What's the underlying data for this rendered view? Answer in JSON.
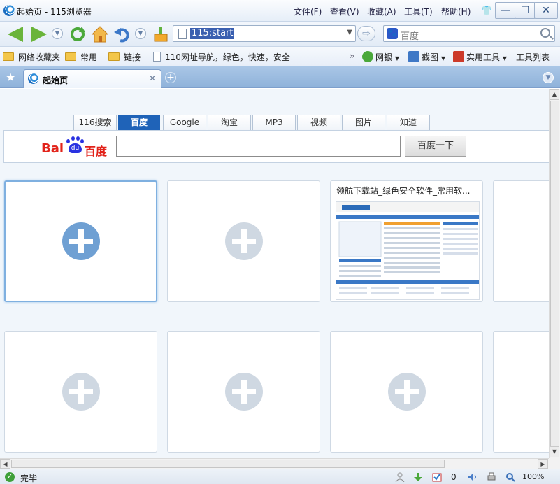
{
  "window": {
    "title": "起始页 - 115浏览器",
    "menu": [
      "文件(F)",
      "查看(V)",
      "收藏(A)",
      "工具(T)",
      "帮助(H)"
    ]
  },
  "navbar": {
    "url": "115:start",
    "search_placeholder": "百度"
  },
  "bookmarks": {
    "left": [
      {
        "label": "网络收藏夹",
        "icon": "folder-icon"
      },
      {
        "label": "常用",
        "icon": "folder-icon"
      },
      {
        "label": "链接",
        "icon": "folder-icon"
      },
      {
        "label": "110网址导航，绿色，快速，安全",
        "icon": "page-icon"
      }
    ],
    "right": [
      {
        "label": "网银",
        "icon": "bank-icon"
      },
      {
        "label": "截图",
        "icon": "screenshot-icon"
      },
      {
        "label": "实用工具",
        "icon": "toolbox-icon"
      },
      {
        "label": "工具列表",
        "icon": ""
      }
    ]
  },
  "tabs": {
    "active": "起始页"
  },
  "search_panel": {
    "tabs": [
      "116搜索",
      "百度",
      "Google",
      "淘宝",
      "MP3",
      "视频",
      "图片",
      "知道"
    ],
    "active_tab": "百度",
    "logo_text_left": "Bai",
    "logo_text_du": "du",
    "logo_text_right": "百度",
    "button_label": "百度一下",
    "input_value": ""
  },
  "speed_dial": {
    "tile_3_title": "领航下载站_绿色安全软件_常用软..."
  },
  "status": {
    "text": "完毕",
    "count": "0",
    "zoom": "100%"
  },
  "colors": {
    "accent": "#1f63b8",
    "tab_bar": "#8fb2da"
  }
}
